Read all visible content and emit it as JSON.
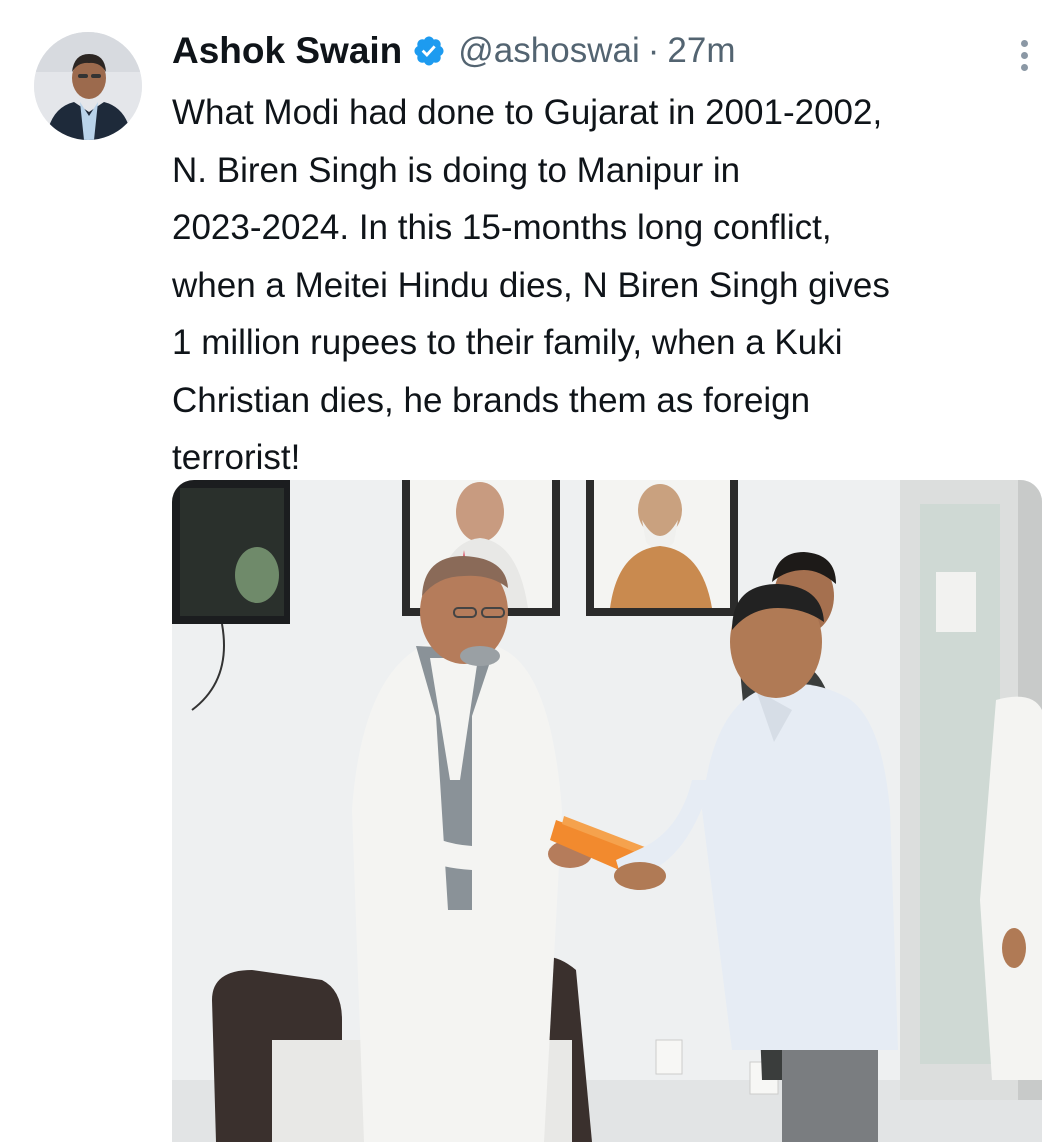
{
  "author": {
    "name": "Ashok Swain",
    "handle": "@ashoswai",
    "separator": "·",
    "time": "27m",
    "verified": true,
    "avatar_icon": "profile-photo"
  },
  "tweet": {
    "lines": [
      "What Modi had done to Gujarat in 2001-2002,",
      "N. Biren Singh is doing to Manipur in",
      "2023-2024. In this 15-months long conflict,",
      "when a Meitei Hindu dies, N Biren Singh gives",
      "1 million rupees to their family, when a Kuki",
      "Christian dies, he brands them as foreign",
      "terrorist!"
    ]
  },
  "media": {
    "description_icon": "photo",
    "portrait_caption_left": "",
    "portrait_caption_right": ""
  },
  "colors": {
    "verified": "#1d9bf0",
    "text": "#0f1419",
    "secondary": "#536471",
    "envelope": "#f28a2e"
  },
  "icons": {
    "more": "more-vertical-icon",
    "verified": "verified-badge-icon"
  }
}
